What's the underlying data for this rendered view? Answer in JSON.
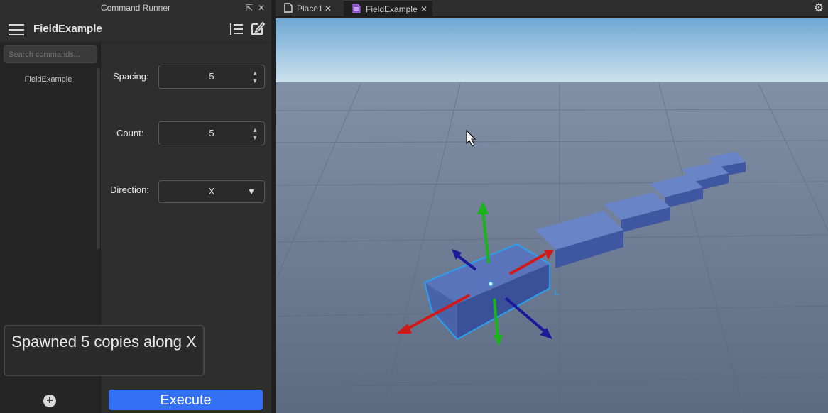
{
  "panel": {
    "title": "Command Runner",
    "command_name": "FieldExample",
    "search_placeholder": "Search commands...",
    "commands": [
      "FieldExample"
    ]
  },
  "fields": {
    "spacing": {
      "label": "Spacing:",
      "value": "5"
    },
    "count": {
      "label": "Count:",
      "value": "5"
    },
    "direction": {
      "label": "Direction:",
      "value": "X"
    }
  },
  "output_text": "Spawned 5 copies along X",
  "execute_label": "Execute",
  "tabs": [
    {
      "label": "Place1"
    },
    {
      "label": "FieldExample"
    }
  ],
  "colors": {
    "accent": "#3470f4",
    "sky": "#7ab0d8",
    "ground": "#6f7d93",
    "part": "#4a63a8",
    "selection": "#2aa0f0",
    "axis_x": "#d01919",
    "axis_y": "#18b418",
    "axis_z": "#1a1a9a"
  },
  "icons": {
    "menu": "hamburger-icon",
    "list": "list-icon",
    "edit": "edit-icon",
    "settings": "gear-icon"
  }
}
